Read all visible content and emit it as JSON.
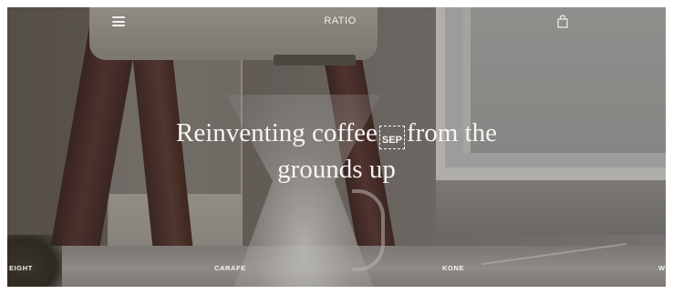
{
  "header": {
    "menu_icon": "hamburger-menu-icon",
    "brand": "RATIO",
    "cart_icon": "shopping-bag-icon"
  },
  "hero": {
    "line1_before": "Reinventing coffee",
    "sep_glyph": "SEP",
    "line1_after": "from the",
    "line2": "grounds up"
  },
  "product_nav": {
    "items": [
      "EIGHT",
      "CARAFE",
      "KONE",
      "W"
    ]
  },
  "colors": {
    "text": "#f7f5f2",
    "wood": "#563530",
    "overlay": "#282420"
  }
}
